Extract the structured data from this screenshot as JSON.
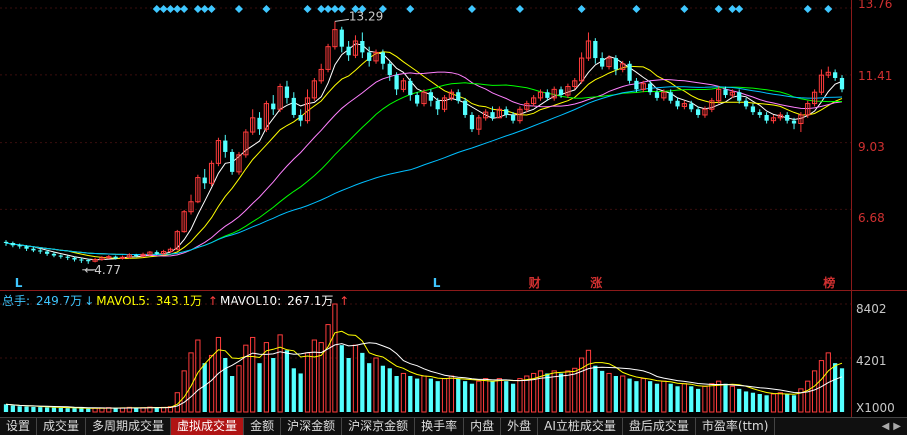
{
  "chart_data": {
    "type": "candlestick",
    "price_axis": {
      "labels": [
        "13.76",
        "11.41",
        "9.03",
        "6.68"
      ],
      "ymin": 4.2,
      "ymax": 13.9
    },
    "annotations": {
      "high": "13.29",
      "low": "4.77"
    },
    "markers": [
      {
        "text": "L",
        "color": "#3fc7ff"
      },
      {
        "text": "L",
        "color": "#3fc7ff"
      },
      {
        "text": "财",
        "color": "#d03030"
      },
      {
        "text": "涨",
        "color": "#d03030"
      },
      {
        "text": "榜",
        "color": "#d03030"
      }
    ],
    "candles": [
      [
        5.54,
        5.5,
        5.6,
        5.4
      ],
      [
        5.5,
        5.42,
        5.55,
        5.35
      ],
      [
        5.42,
        5.38,
        5.48,
        5.3
      ],
      [
        5.38,
        5.3,
        5.42,
        5.22
      ],
      [
        5.3,
        5.24,
        5.35,
        5.18
      ],
      [
        5.24,
        5.2,
        5.3,
        5.12
      ],
      [
        5.2,
        5.12,
        5.25,
        5.05
      ],
      [
        5.12,
        5.06,
        5.18,
        5.0
      ],
      [
        5.06,
        5.02,
        5.1,
        4.95
      ],
      [
        5.02,
        4.98,
        5.06,
        4.9
      ],
      [
        4.98,
        4.92,
        5.02,
        4.85
      ],
      [
        4.92,
        4.9,
        4.98,
        4.8
      ],
      [
        4.9,
        4.86,
        4.95,
        4.77
      ],
      [
        4.86,
        4.92,
        4.98,
        4.82
      ],
      [
        4.92,
        4.98,
        5.04,
        4.88
      ],
      [
        4.98,
        5.02,
        5.08,
        4.94
      ],
      [
        5.02,
        4.96,
        5.06,
        4.92
      ],
      [
        4.96,
        5.0,
        5.06,
        4.92
      ],
      [
        5.0,
        5.08,
        5.14,
        4.96
      ],
      [
        5.08,
        5.04,
        5.12,
        5.0
      ],
      [
        5.04,
        5.1,
        5.16,
        5.0
      ],
      [
        5.1,
        5.18,
        5.22,
        5.06
      ],
      [
        5.18,
        5.12,
        5.24,
        5.08
      ],
      [
        5.12,
        5.2,
        5.26,
        5.08
      ],
      [
        5.2,
        5.28,
        5.34,
        5.16
      ],
      [
        5.28,
        5.9,
        5.96,
        5.24
      ],
      [
        5.9,
        6.6,
        6.66,
        5.86
      ],
      [
        6.6,
        6.95,
        7.2,
        6.5
      ],
      [
        6.95,
        7.8,
        7.9,
        6.9
      ],
      [
        7.8,
        7.6,
        8.1,
        7.4
      ],
      [
        7.6,
        8.3,
        8.4,
        7.5
      ],
      [
        8.3,
        9.1,
        9.2,
        8.2
      ],
      [
        9.1,
        8.7,
        9.3,
        8.5
      ],
      [
        8.7,
        8.0,
        8.8,
        7.9
      ],
      [
        8.0,
        8.6,
        8.7,
        7.9
      ],
      [
        8.6,
        9.4,
        9.5,
        8.5
      ],
      [
        9.4,
        9.9,
        10.2,
        9.3
      ],
      [
        9.9,
        9.5,
        10.1,
        9.3
      ],
      [
        9.5,
        10.4,
        10.5,
        9.4
      ],
      [
        10.4,
        10.2,
        10.7,
        10.0
      ],
      [
        10.2,
        11.0,
        11.1,
        10.1
      ],
      [
        11.0,
        10.6,
        11.2,
        10.4
      ],
      [
        10.6,
        10.0,
        10.8,
        9.9
      ],
      [
        10.0,
        9.8,
        10.2,
        9.6
      ],
      [
        9.8,
        10.6,
        10.9,
        9.7
      ],
      [
        10.6,
        11.2,
        11.3,
        10.5
      ],
      [
        11.2,
        11.6,
        11.8,
        11.1
      ],
      [
        11.6,
        12.4,
        12.5,
        11.5
      ],
      [
        12.4,
        13.0,
        13.29,
        12.3
      ],
      [
        13.0,
        12.4,
        13.1,
        12.2
      ],
      [
        12.4,
        12.1,
        12.6,
        11.9
      ],
      [
        12.1,
        12.6,
        12.8,
        12.0
      ],
      [
        12.6,
        12.2,
        12.9,
        12.0
      ],
      [
        12.2,
        11.9,
        12.4,
        11.7
      ],
      [
        11.9,
        12.2,
        12.3,
        11.8
      ],
      [
        12.2,
        11.8,
        12.3,
        11.6
      ],
      [
        11.8,
        11.4,
        11.9,
        11.2
      ],
      [
        11.4,
        10.9,
        11.5,
        10.7
      ],
      [
        10.9,
        11.2,
        11.3,
        10.8
      ],
      [
        11.2,
        10.7,
        11.3,
        10.5
      ],
      [
        10.7,
        10.4,
        10.8,
        10.3
      ],
      [
        10.4,
        10.8,
        10.9,
        10.3
      ],
      [
        10.8,
        10.5,
        10.9,
        10.3
      ],
      [
        10.5,
        10.2,
        10.6,
        10.0
      ],
      [
        10.2,
        10.6,
        10.7,
        10.1
      ],
      [
        10.6,
        10.8,
        10.9,
        10.5
      ],
      [
        10.8,
        10.5,
        10.9,
        10.4
      ],
      [
        10.5,
        10.0,
        10.6,
        9.9
      ],
      [
        10.0,
        9.5,
        10.1,
        9.4
      ],
      [
        9.5,
        9.9,
        10.0,
        9.3
      ],
      [
        9.9,
        10.1,
        10.2,
        9.8
      ],
      [
        10.1,
        9.9,
        10.3,
        9.8
      ],
      [
        9.9,
        10.2,
        10.3,
        9.9
      ],
      [
        10.2,
        10.0,
        10.3,
        9.9
      ],
      [
        10.0,
        9.8,
        10.1,
        9.7
      ],
      [
        9.8,
        10.2,
        10.3,
        9.7
      ],
      [
        10.2,
        10.4,
        10.5,
        10.1
      ],
      [
        10.4,
        10.6,
        10.7,
        10.3
      ],
      [
        10.6,
        10.8,
        10.9,
        10.5
      ],
      [
        10.8,
        10.6,
        10.9,
        10.5
      ],
      [
        10.6,
        10.9,
        11.0,
        10.5
      ],
      [
        10.9,
        10.7,
        11.0,
        10.6
      ],
      [
        10.7,
        11.0,
        11.1,
        10.6
      ],
      [
        11.0,
        11.2,
        11.3,
        10.9
      ],
      [
        11.2,
        12.0,
        12.2,
        11.1
      ],
      [
        12.0,
        12.6,
        12.9,
        11.9
      ],
      [
        12.6,
        12.0,
        12.7,
        11.8
      ],
      [
        12.0,
        11.7,
        12.2,
        11.6
      ],
      [
        11.7,
        12.0,
        12.1,
        11.6
      ],
      [
        12.0,
        11.6,
        12.1,
        11.4
      ],
      [
        11.6,
        11.8,
        11.9,
        11.5
      ],
      [
        11.8,
        11.2,
        11.9,
        11.1
      ],
      [
        11.2,
        10.9,
        11.3,
        10.8
      ],
      [
        10.9,
        11.1,
        11.2,
        10.8
      ],
      [
        11.1,
        10.8,
        11.2,
        10.7
      ],
      [
        10.8,
        10.6,
        10.9,
        10.5
      ],
      [
        10.6,
        10.8,
        10.9,
        10.5
      ],
      [
        10.8,
        10.5,
        10.9,
        10.4
      ],
      [
        10.5,
        10.3,
        10.6,
        10.2
      ],
      [
        10.3,
        10.4,
        10.5,
        10.2
      ],
      [
        10.4,
        10.2,
        10.5,
        10.1
      ],
      [
        10.2,
        10.0,
        10.3,
        9.9
      ],
      [
        10.0,
        10.2,
        10.3,
        9.9
      ],
      [
        10.2,
        10.5,
        10.6,
        10.1
      ],
      [
        10.5,
        10.9,
        11.0,
        10.4
      ],
      [
        10.9,
        10.7,
        11.0,
        10.6
      ],
      [
        10.7,
        10.8,
        10.9,
        10.6
      ],
      [
        10.8,
        10.5,
        10.9,
        10.4
      ],
      [
        10.5,
        10.3,
        10.6,
        10.2
      ],
      [
        10.3,
        10.1,
        10.4,
        10.0
      ],
      [
        10.1,
        10.0,
        10.2,
        9.9
      ],
      [
        10.0,
        9.8,
        10.1,
        9.7
      ],
      [
        9.8,
        9.9,
        10.0,
        9.7
      ],
      [
        9.9,
        10.0,
        10.1,
        9.8
      ],
      [
        10.0,
        9.8,
        10.1,
        9.7
      ],
      [
        9.8,
        9.7,
        9.9,
        9.5
      ],
      [
        9.7,
        10.0,
        10.1,
        9.4
      ],
      [
        10.0,
        10.4,
        10.5,
        9.9
      ],
      [
        10.4,
        10.8,
        10.9,
        10.3
      ],
      [
        10.8,
        11.4,
        11.6,
        10.7
      ],
      [
        11.4,
        11.5,
        11.7,
        11.3
      ],
      [
        11.5,
        11.3,
        11.6,
        11.2
      ],
      [
        11.3,
        10.9,
        11.4,
        10.8
      ]
    ],
    "volume_axis": {
      "labels": [
        "8402",
        "4201",
        "X1000"
      ],
      "max": 8402
    },
    "volumes": [
      600,
      500,
      450,
      420,
      400,
      380,
      360,
      340,
      320,
      300,
      300,
      280,
      260,
      300,
      320,
      340,
      300,
      320,
      360,
      320,
      340,
      380,
      340,
      360,
      420,
      1500,
      3200,
      4600,
      5600,
      3800,
      4400,
      5800,
      4200,
      2800,
      3600,
      5200,
      5800,
      3800,
      5400,
      4200,
      6000,
      4800,
      3400,
      3000,
      4600,
      5600,
      5400,
      6800,
      8402,
      5200,
      4200,
      5200,
      4600,
      3800,
      4200,
      3600,
      3400,
      2800,
      3000,
      2800,
      2600,
      2800,
      2600,
      2400,
      2600,
      2800,
      2600,
      2400,
      2200,
      2400,
      2600,
      2400,
      2600,
      2400,
      2200,
      2600,
      2800,
      3000,
      3200,
      3000,
      3200,
      3000,
      3200,
      3400,
      4200,
      4800,
      3600,
      3200,
      3000,
      2800,
      2800,
      2600,
      2400,
      2600,
      2400,
      2200,
      2400,
      2200,
      2000,
      2200,
      2000,
      1800,
      2000,
      2200,
      2400,
      2200,
      2000,
      1800,
      1600,
      1500,
      1400,
      1300,
      1400,
      1500,
      1400,
      1300,
      1800,
      2400,
      3200,
      4000,
      4600,
      3800,
      3400
    ]
  },
  "volume_header": {
    "total_label": "总手:",
    "total_value": "249.7万",
    "ma5_label": "MAVOL5:",
    "ma5_value": "343.1万",
    "ma10_label": "MAVOL10:",
    "ma10_value": "267.1万",
    "arrow_down": "↓",
    "arrow_up": "↑"
  },
  "tabs": [
    {
      "label": "设置",
      "active": false
    },
    {
      "label": "成交量",
      "active": false
    },
    {
      "label": "多周期成交量",
      "active": false
    },
    {
      "label": "虚拟成交量",
      "active": true
    },
    {
      "label": "金额",
      "active": false
    },
    {
      "label": "沪深金额",
      "active": false
    },
    {
      "label": "沪深京金额",
      "active": false
    },
    {
      "label": "换手率",
      "active": false
    },
    {
      "label": "内盘",
      "active": false
    },
    {
      "label": "外盘",
      "active": false
    },
    {
      "label": "AI立桩成交量",
      "active": false
    },
    {
      "label": "盘后成交量",
      "active": false
    },
    {
      "label": "市盈率(ttm)",
      "active": false
    }
  ],
  "colors": {
    "up": "#ff3c3c",
    "down": "#54ffff",
    "ma5": "#ffffff",
    "ma10": "#ffff00",
    "ma20": "#ff80ff",
    "ma30": "#00ff00",
    "ma60": "#00bfff",
    "diamond": "#3fc7ff"
  }
}
